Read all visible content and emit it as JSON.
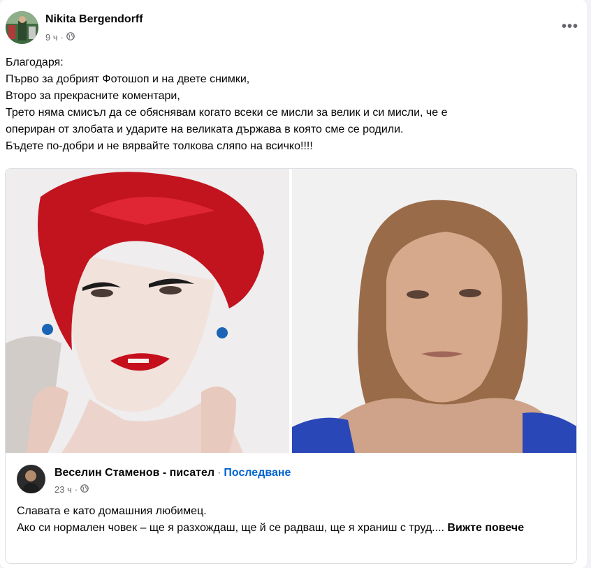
{
  "post": {
    "author_name": "Nikita Bergendorff",
    "time": "9 ч",
    "meta_separator": "·",
    "visibility_icon": "globe-icon",
    "more_label": "•••",
    "text_lines": [
      "Благодаря:",
      "Първо за добрият Фотошоп и на двете снимки,",
      "Второ за прекрасните коментари,",
      "Трето няма смисъл да се обяснявам когато всеки се мисли за велик и си мисли, че е",
      "опериран от злобата и ударите на великата държава в която сме се родили.",
      "Бъдете по-добри и не вярвайте толкова сляпо на всичко!!!!"
    ]
  },
  "shared": {
    "author_name": "Веселин Стаменов - писател",
    "separator": "·",
    "follow_label": "Последване",
    "time": "23 ч",
    "meta_separator": "·",
    "visibility_icon": "globe-icon",
    "text_line1": "Славата е като домашния любимец.",
    "text_line2": "Ако си нормален човек – ще я разхождаш, ще й се радваш, ще я храниш с труд....",
    "see_more_label": "Вижте повече"
  },
  "colors": {
    "link_blue": "#0064d1",
    "secondary_text": "#65676b"
  }
}
